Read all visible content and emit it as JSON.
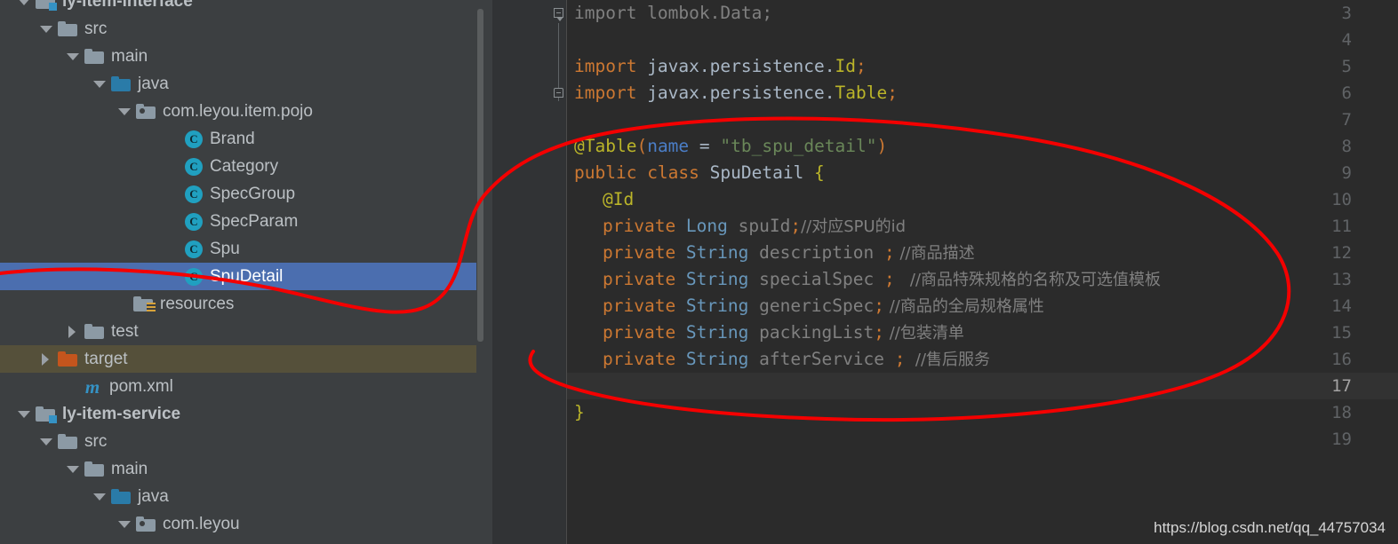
{
  "sidebar": {
    "scrollbar_label": "project-tree-scrollbar",
    "rows": [
      {
        "label": "ly-item-interface",
        "icon": "module-folder-icon",
        "arrow": "down",
        "indent": 20,
        "bold": true,
        "state": "clipped"
      },
      {
        "label": "src",
        "icon": "folder-icon",
        "arrow": "down",
        "indent": 45,
        "bold": false,
        "state": "normal"
      },
      {
        "label": "main",
        "icon": "folder-icon",
        "arrow": "down",
        "indent": 75,
        "bold": false,
        "state": "normal"
      },
      {
        "label": "java",
        "icon": "source-folder-icon",
        "arrow": "down",
        "indent": 105,
        "bold": false,
        "state": "normal"
      },
      {
        "label": "com.leyou.item.pojo",
        "icon": "package-icon",
        "arrow": "down",
        "indent": 133,
        "bold": false,
        "state": "normal"
      },
      {
        "label": "Brand",
        "icon": "java-class-icon",
        "arrow": "none",
        "indent": 188,
        "bold": false,
        "state": "normal"
      },
      {
        "label": "Category",
        "icon": "java-class-icon",
        "arrow": "none",
        "indent": 188,
        "bold": false,
        "state": "normal"
      },
      {
        "label": "SpecGroup",
        "icon": "java-class-icon",
        "arrow": "none",
        "indent": 188,
        "bold": false,
        "state": "normal"
      },
      {
        "label": "SpecParam",
        "icon": "java-class-icon",
        "arrow": "none",
        "indent": 188,
        "bold": false,
        "state": "normal"
      },
      {
        "label": "Spu",
        "icon": "java-class-icon",
        "arrow": "none",
        "indent": 188,
        "bold": false,
        "state": "normal"
      },
      {
        "label": "SpuDetail",
        "icon": "java-class-icon",
        "arrow": "none",
        "indent": 188,
        "bold": false,
        "state": "selected"
      },
      {
        "label": "resources",
        "icon": "resources-folder-icon",
        "arrow": "none",
        "indent": 130,
        "bold": false,
        "state": "normal"
      },
      {
        "label": "test",
        "icon": "folder-icon",
        "arrow": "right",
        "indent": 75,
        "bold": false,
        "state": "normal"
      },
      {
        "label": "target",
        "icon": "excluded-folder-icon",
        "arrow": "right",
        "indent": 45,
        "bold": false,
        "state": "marked"
      },
      {
        "label": "pom.xml",
        "icon": "maven-icon",
        "arrow": "none",
        "indent": 73,
        "bold": false,
        "state": "normal"
      },
      {
        "label": "ly-item-service",
        "icon": "module-folder-icon",
        "arrow": "down",
        "indent": 20,
        "bold": true,
        "state": "normal"
      },
      {
        "label": "src",
        "icon": "folder-icon",
        "arrow": "down",
        "indent": 45,
        "bold": false,
        "state": "normal"
      },
      {
        "label": "main",
        "icon": "folder-icon",
        "arrow": "down",
        "indent": 75,
        "bold": false,
        "state": "normal"
      },
      {
        "label": "java",
        "icon": "source-folder-icon",
        "arrow": "down",
        "indent": 105,
        "bold": false,
        "state": "normal"
      },
      {
        "label": "com.leyou",
        "icon": "package-icon",
        "arrow": "down",
        "indent": 133,
        "bold": false,
        "state": "normal"
      }
    ]
  },
  "editor": {
    "gutter_name": "line-number-gutter",
    "current_line": 17,
    "first_line": 3,
    "last_line": 19,
    "lines": [
      {
        "n": 3,
        "fold": "open-arrow"
      },
      {
        "n": 4,
        "fold": ""
      },
      {
        "n": 5,
        "fold": ""
      },
      {
        "n": 6,
        "fold": "close"
      },
      {
        "n": 7,
        "fold": ""
      },
      {
        "n": 8,
        "fold": ""
      },
      {
        "n": 9,
        "fold": ""
      },
      {
        "n": 10,
        "fold": ""
      },
      {
        "n": 11,
        "fold": ""
      },
      {
        "n": 12,
        "fold": ""
      },
      {
        "n": 13,
        "fold": ""
      },
      {
        "n": 14,
        "fold": ""
      },
      {
        "n": 15,
        "fold": ""
      },
      {
        "n": 16,
        "fold": ""
      },
      {
        "n": 17,
        "fold": ""
      },
      {
        "n": 18,
        "fold": ""
      },
      {
        "n": 19,
        "fold": ""
      }
    ],
    "code": {
      "l3": "import lombok.Data;",
      "l5_kw": "import ",
      "l5_pkg": "javax.persistence.",
      "l5_cls": "Id",
      "l5_end": ";",
      "l6_kw": "import ",
      "l6_pkg": "javax.persistence.",
      "l6_cls": "Table",
      "l6_end": ";",
      "l8_anno": "@Table",
      "l8_lp": "(",
      "l8_param": "name",
      "l8_eq": " = ",
      "l8_str": "\"tb_spu_detail\"",
      "l8_rp": ")",
      "l9_pub": "public ",
      "l9_cls_kw": "class ",
      "l9_name": "SpuDetail ",
      "l9_brace": "{",
      "l10_id": "@Id",
      "l11_mod": "private ",
      "l11_type": "Long ",
      "l11_name": "spuId",
      "l11_semi": ";",
      "l11_cmt": "//对应SPU的id",
      "l12_mod": "private ",
      "l12_type": "String ",
      "l12_name": "description ",
      "l12_semi": ";",
      "l12_cmt": " //商品描述",
      "l13_mod": "private ",
      "l13_type": "String ",
      "l13_name": "specialSpec ",
      "l13_semi": ";",
      "l13_cmt": "   //商品特殊规格的名称及可选值模板",
      "l14_mod": "private ",
      "l14_type": "String ",
      "l14_name": "genericSpec",
      "l14_semi": ";",
      "l14_cmt": " //商品的全局规格属性",
      "l15_mod": "private ",
      "l15_type": "String ",
      "l15_name": "packingList",
      "l15_semi": ";",
      "l15_cmt": " //包装清单",
      "l16_mod": "private ",
      "l16_type": "String ",
      "l16_name": "afterService ",
      "l16_semi": ";",
      "l16_cmt": "  //售后服务",
      "l18_close": "}"
    }
  },
  "annotation": {
    "name": "red-ellipse-annotation",
    "color": "#f40000",
    "stroke_width": 4
  },
  "watermark": {
    "text": "https://blog.csdn.net/qq_44757034"
  },
  "colors": {
    "sidebar_bg": "#3c3f41",
    "editor_bg": "#2b2b2b",
    "gutter_bg": "#313335",
    "selection_blue": "#4b6eaf",
    "excluded_olive": "#55503a",
    "keyword_orange": "#cc7832",
    "annotation_yellow": "#bbb529",
    "string_green": "#6a8759",
    "comment_gray": "#808080",
    "text_gray": "#a9b7c6",
    "param_blue": "#4b7ec7"
  }
}
